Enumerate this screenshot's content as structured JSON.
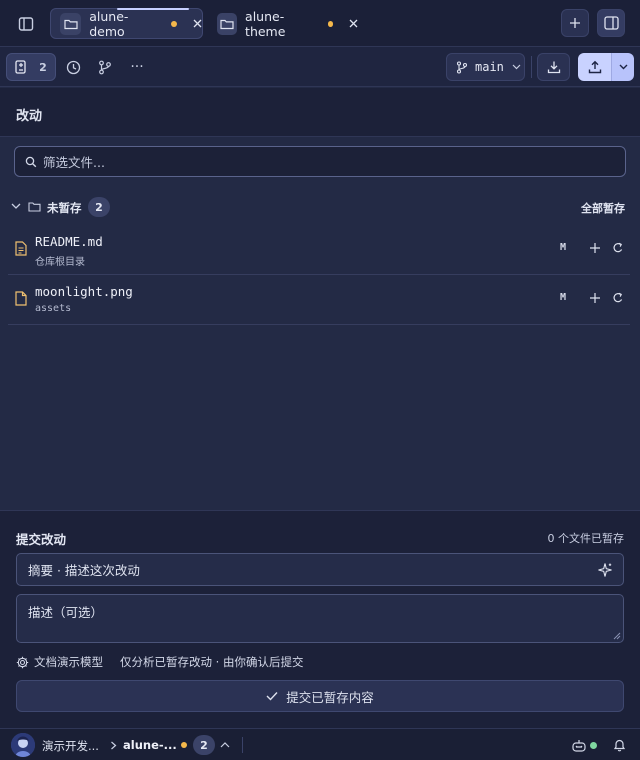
{
  "tabs": [
    {
      "label": "alune-demo",
      "active": true,
      "modified": true
    },
    {
      "label": "alune-theme",
      "active": false,
      "modified": true
    }
  ],
  "toolbar": {
    "changes_count": "2",
    "branch": "main"
  },
  "section": {
    "title": "改动"
  },
  "filter": {
    "placeholder": "筛选文件..."
  },
  "unstaged_group": {
    "label": "未暂存",
    "count": "2",
    "stage_all": "全部暂存"
  },
  "files": [
    {
      "name": "README.md",
      "path": "仓库根目录",
      "status": "M"
    },
    {
      "name": "moonlight.png",
      "path": "assets",
      "status": "M"
    }
  ],
  "commit": {
    "title": "提交改动",
    "staged_count": "0 个文件已暂存",
    "summary_placeholder": "摘要 · 描述这次改动",
    "description_placeholder": "描述（可选）",
    "model_label": "文档演示模型",
    "model_note": "仅分析已暂存改动 · 由你确认后提交",
    "commit_button": "提交已暂存内容"
  },
  "statusbar": {
    "workspace": "演示开发...",
    "repo": "alune-...",
    "count": "2"
  },
  "colors": {
    "accent": "#c7d0ff",
    "modified_dot": "#f5b84b",
    "online_dot": "#7fd7a0"
  }
}
